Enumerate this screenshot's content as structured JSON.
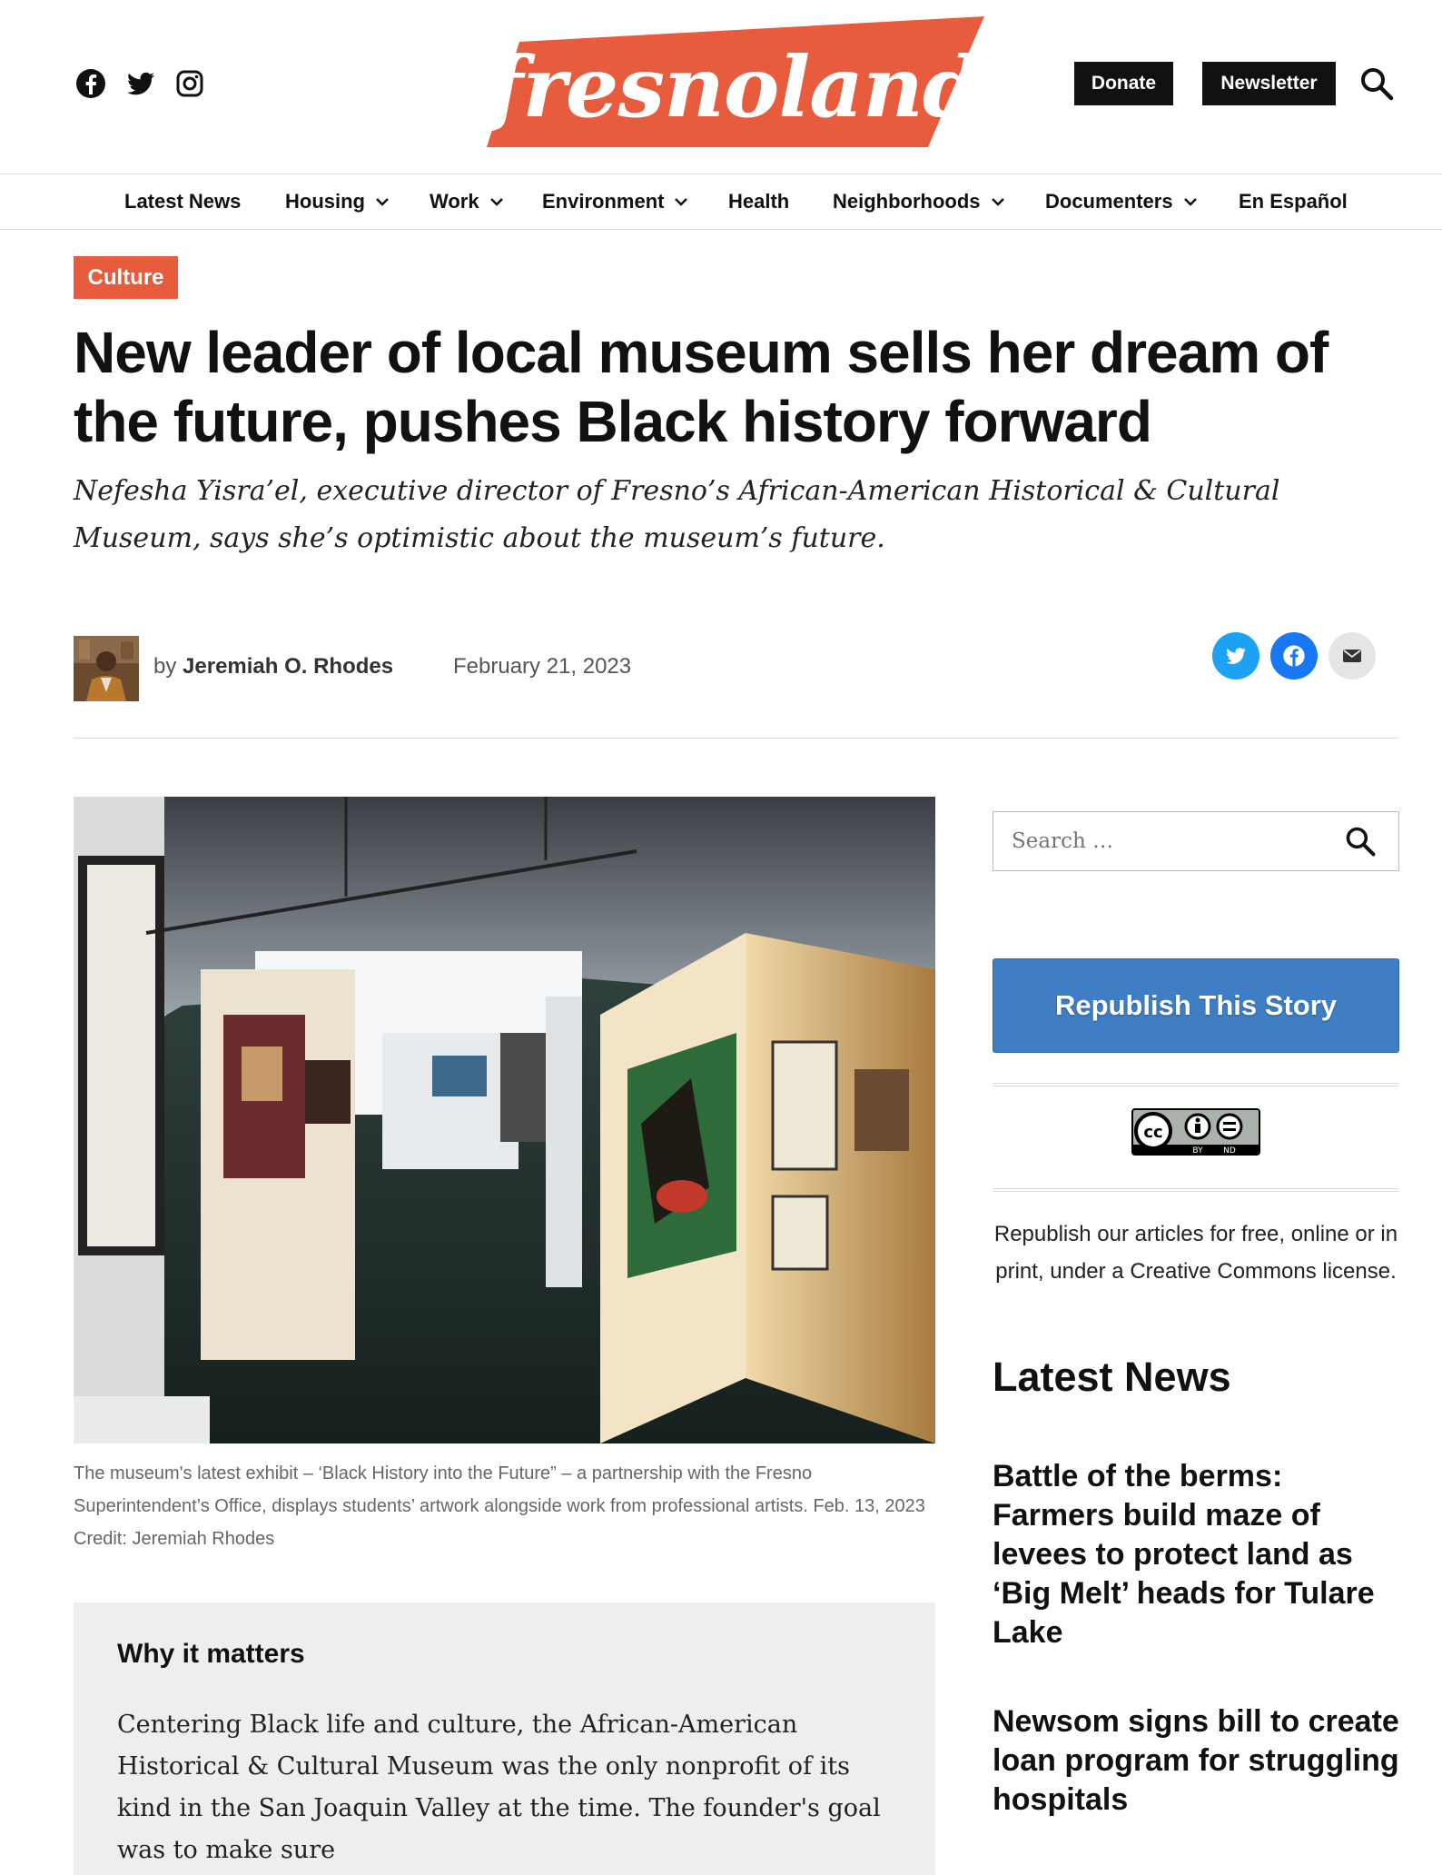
{
  "header": {
    "social": [
      "facebook-icon",
      "twitter-icon",
      "instagram-icon"
    ],
    "logo_text": "fresnoland",
    "donate_label": "Donate",
    "newsletter_label": "Newsletter",
    "brand_color": "#e85c3e"
  },
  "nav": {
    "items": [
      {
        "label": "Latest News",
        "dropdown": false
      },
      {
        "label": "Housing",
        "dropdown": true
      },
      {
        "label": "Work",
        "dropdown": true
      },
      {
        "label": "Environment",
        "dropdown": true
      },
      {
        "label": "Health",
        "dropdown": false
      },
      {
        "label": "Neighborhoods",
        "dropdown": true
      },
      {
        "label": "Documenters",
        "dropdown": true
      },
      {
        "label": "En Español",
        "dropdown": false
      }
    ]
  },
  "article": {
    "category": "Culture",
    "headline": "New leader of local museum sells her dream of the future, pushes Black history forward",
    "dek": "Nefesha Yisra’el, executive director of Fresno’s African-American Historical & Cultural Museum, says she’s optimistic about the museum’s future.",
    "by_prefix": "by",
    "author": "Jeremiah O. Rhodes",
    "date": "February 21, 2023",
    "share": [
      {
        "icon": "twitter-icon",
        "color": "#1da1f2"
      },
      {
        "icon": "facebook-icon",
        "color": "#1877f2"
      },
      {
        "icon": "email-icon",
        "color": "#e5e5e5"
      }
    ],
    "caption": "The museum's latest exhibit – ‘Black History into the Future” – a partnership with the Fresno Superintendent’s Office, displays students’ artwork alongside work from professional artists. Feb. 13, 2023 Credit: Jeremiah Rhodes",
    "why_title": "Why it matters",
    "why_text": "Centering Black life and culture, the African-American Historical & Cultural Museum was the only nonprofit of its kind in the San Joaquin Valley at the time. The founder's goal was to make sure"
  },
  "sidebar": {
    "search_placeholder": "Search …",
    "republish_label": "Republish This Story",
    "cc_by": "BY",
    "cc_nd": "ND",
    "republish_text": "Republish our articles for free, online or in print, under a Creative Commons license.",
    "latest_heading": "Latest News",
    "stories": [
      "Battle of the berms: Farmers build maze of levees to protect land as ‘Big Melt’ heads for Tulare Lake",
      "Newsom signs bill to create loan program for struggling hospitals"
    ]
  }
}
